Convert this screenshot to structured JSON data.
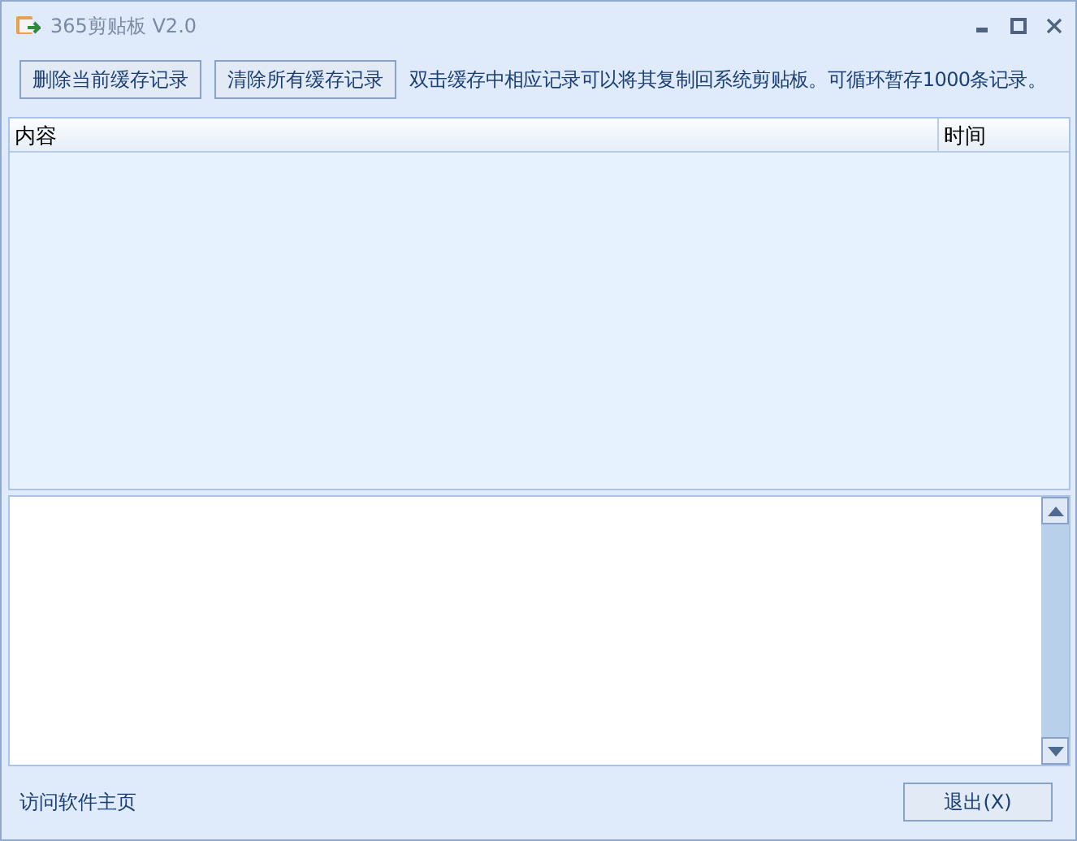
{
  "window": {
    "title": "365剪贴板 V2.0"
  },
  "toolbar": {
    "buttons": [
      "删除当前缓存记录",
      "清除所有缓存记录"
    ],
    "hint": "双击缓存中相应记录可以将其复制回系统剪贴板。可循环暂存1000条记录。"
  },
  "table": {
    "columns": [
      "内容",
      "时间"
    ]
  },
  "footer": {
    "link": "访问软件主页",
    "exit_button": "退出(X)"
  }
}
